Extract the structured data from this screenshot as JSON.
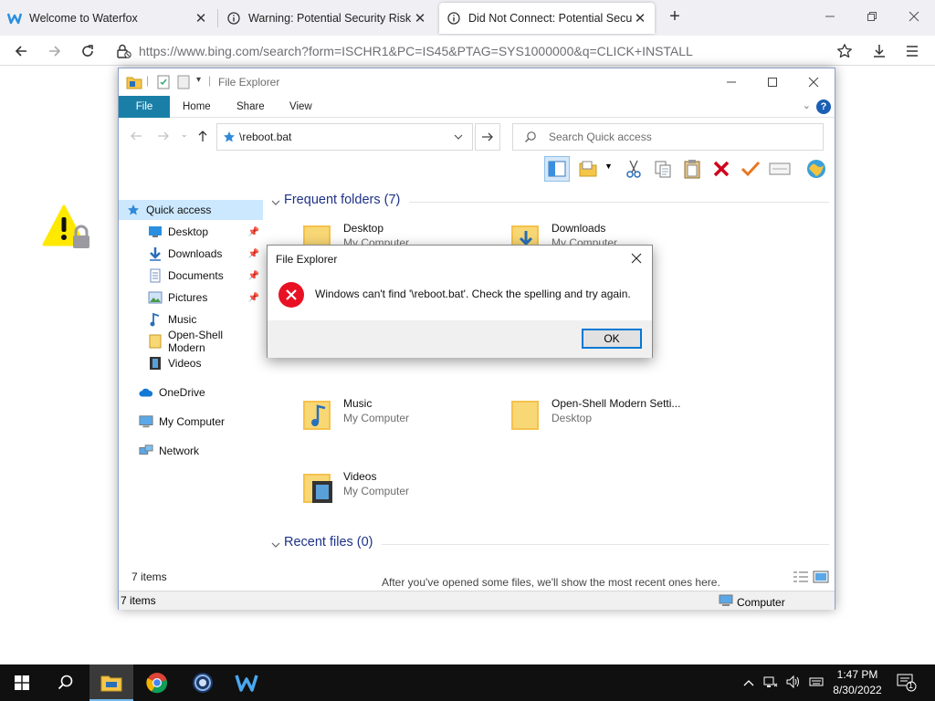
{
  "browser": {
    "tabs": [
      {
        "title": "Welcome to Waterfox",
        "icon": "waterfox-icon"
      },
      {
        "title": "Warning: Potential Security Risk Ah",
        "icon": "info-icon"
      },
      {
        "title": "Did Not Connect: Potential Security",
        "icon": "info-icon",
        "active": true
      }
    ],
    "url": "https://www.bing.com/search?form=ISCHR1&PC=IS45&PTAG=SYS1000000&q=CLICK+INSTALL"
  },
  "explorer": {
    "title": "File Explorer",
    "ribbon_tabs": [
      "File",
      "Home",
      "Share",
      "View"
    ],
    "address": "\\reboot.bat",
    "search_placeholder": "Search Quick access",
    "nav": [
      {
        "label": "Quick access",
        "icon": "star-icon",
        "selected": true
      },
      {
        "label": "Desktop",
        "icon": "desktop-icon",
        "pinned": true
      },
      {
        "label": "Downloads",
        "icon": "download-icon",
        "pinned": true
      },
      {
        "label": "Documents",
        "icon": "documents-icon",
        "pinned": true
      },
      {
        "label": "Pictures",
        "icon": "pictures-icon",
        "pinned": true
      },
      {
        "label": "Music",
        "icon": "music-icon"
      },
      {
        "label": "Open-Shell Modern",
        "icon": "folder-icon"
      },
      {
        "label": "Videos",
        "icon": "videos-icon"
      },
      {
        "label": "OneDrive",
        "icon": "cloud-icon"
      },
      {
        "label": "My Computer",
        "icon": "computer-icon"
      },
      {
        "label": "Network",
        "icon": "network-icon"
      }
    ],
    "frequent_header": "Frequent folders (7)",
    "frequent": [
      {
        "name": "Desktop",
        "sub": "My Computer"
      },
      {
        "name": "Downloads",
        "sub": "My Computer"
      },
      {
        "name": "Music",
        "sub": "My Computer"
      },
      {
        "name": "Open-Shell Modern Setti...",
        "sub": "Desktop"
      },
      {
        "name": "Videos",
        "sub": "My Computer"
      }
    ],
    "recent_header": "Recent files (0)",
    "recent_empty": "After you've opened some files, we'll show the most recent ones here.",
    "items_count": "7 items",
    "status_left": "7 items",
    "status_right": "Computer"
  },
  "dialog": {
    "title": "File Explorer",
    "message": "Windows can't find '\\reboot.bat'. Check the spelling and try again.",
    "ok": "OK"
  },
  "taskbar": {
    "time": "1:47 PM",
    "date": "8/30/2022",
    "notification_count": "1"
  },
  "colors": {
    "file_tab": "#1a7fa7",
    "selection": "#cce8ff",
    "section_header": "#1e3287",
    "error_red": "#e81123",
    "taskbar": "#101010"
  }
}
